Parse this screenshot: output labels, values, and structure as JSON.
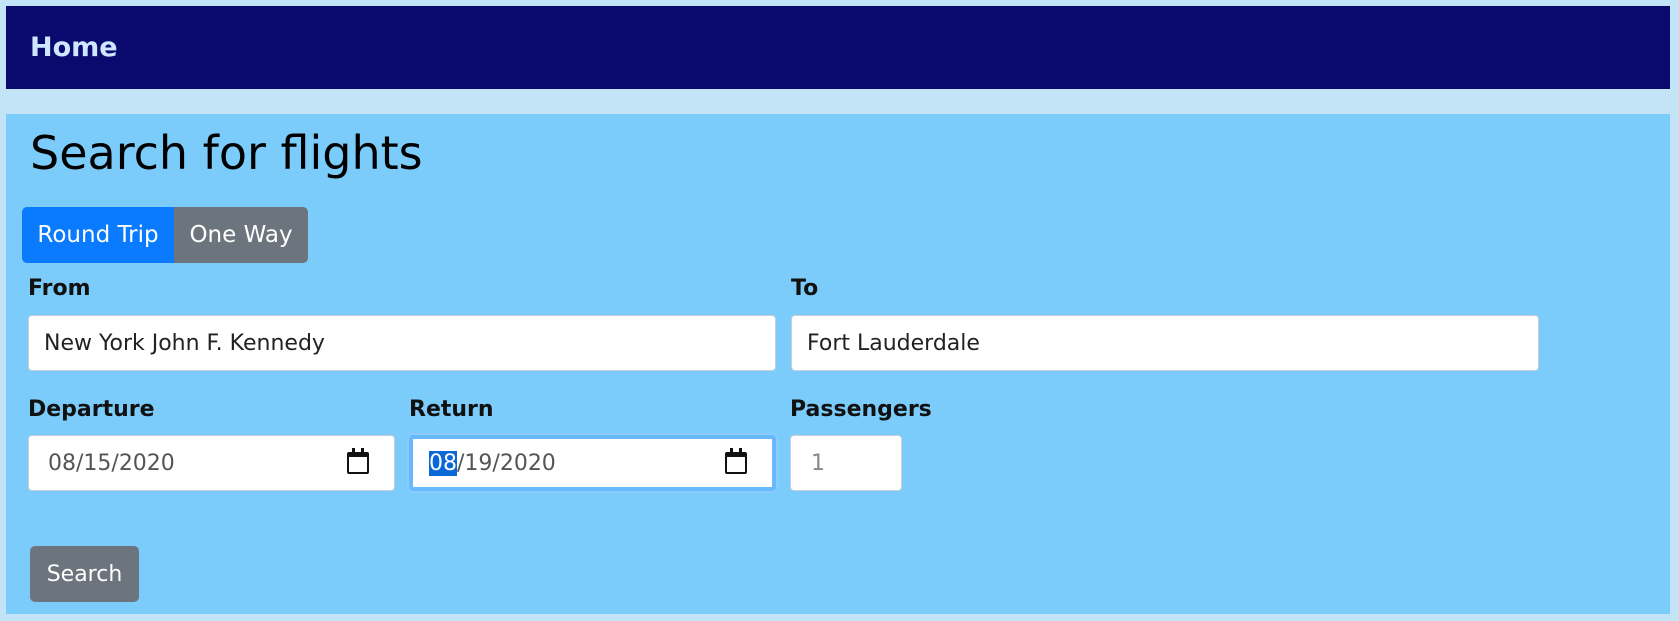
{
  "nav": {
    "home_label": "Home"
  },
  "page": {
    "title": "Search for flights"
  },
  "trip_type": {
    "options": [
      "Round Trip",
      "One Way"
    ],
    "selected": "Round Trip"
  },
  "form": {
    "from": {
      "label": "From",
      "value": "New York John F. Kennedy"
    },
    "to": {
      "label": "To",
      "value": "Fort Lauderdale"
    },
    "departure": {
      "label": "Departure",
      "value": "08/15/2020"
    },
    "return": {
      "label": "Return",
      "value": "08/19/2020",
      "selected_segment": "08",
      "rest_of_value": "/19/2020"
    },
    "passengers": {
      "label": "Passengers",
      "value": "1"
    },
    "search_label": "Search"
  },
  "colors": {
    "nav_bg": "#0a0a6e",
    "page_bg": "#c3e4f7",
    "main_bg": "#7bccfb",
    "primary": "#0a7bff",
    "secondary": "#6c757d"
  },
  "icons": {
    "date_picker": "calendar-icon"
  }
}
